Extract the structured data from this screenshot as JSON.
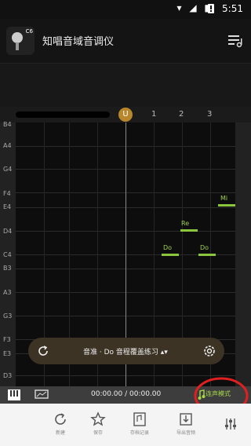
{
  "status_bar": {
    "time": "5:51"
  },
  "app": {
    "title": "知唱音域音调仪",
    "logo_label": "C6"
  },
  "timeline": {
    "marker": "U",
    "beats": [
      "1",
      "2",
      "3"
    ]
  },
  "note_labels": [
    "B4",
    "A4",
    "G4",
    "F4",
    "E4",
    "D4",
    "C4",
    "B3",
    "A3",
    "G3",
    "F3",
    "E3",
    "D3"
  ],
  "notes": [
    {
      "label": "Do"
    },
    {
      "label": "Re"
    },
    {
      "label": "Do"
    },
    {
      "label": "Mi"
    }
  ],
  "exercise": {
    "label": "音准 · Do 音程覆盖练习"
  },
  "player": {
    "time": "00:00.00 / 00:00.00",
    "mode_label": "连声模式"
  },
  "bottom_nav": {
    "items": [
      "新建",
      "保存",
      "存档记录",
      "导出音频"
    ]
  },
  "colors": {
    "accent": "#b8872b",
    "note": "#8cc63f",
    "annotation": "#e02020"
  }
}
